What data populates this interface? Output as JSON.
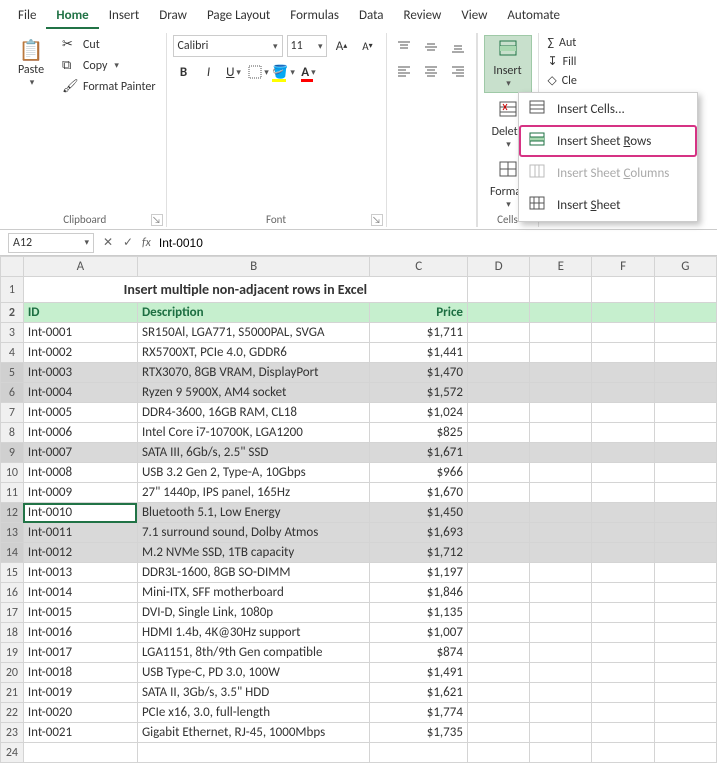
{
  "menu": {
    "items": [
      "File",
      "Home",
      "Insert",
      "Draw",
      "Page Layout",
      "Formulas",
      "Data",
      "Review",
      "View",
      "Automate"
    ],
    "active": "Home"
  },
  "ribbon": {
    "paste": "Paste",
    "cut": "Cut",
    "copy": "Copy",
    "fmtpainter": "Format Painter",
    "clipboard_label": "Clipboard",
    "font_name": "Calibri",
    "font_size": "11",
    "bold": "B",
    "italic": "I",
    "underline": "U",
    "fontA_large": "A",
    "fontA_small": "A",
    "font_label": "Font",
    "insert": "Insert",
    "delete": "Delete",
    "format": "Format",
    "cells_label": "Cells",
    "autosum": "Aut",
    "fill": "Fill",
    "clear": "Cle"
  },
  "dropdown": {
    "insert_cells": "Insert Cells...",
    "insert_rows_pre": "Insert Sheet ",
    "insert_rows_u": "R",
    "insert_rows_post": "ows",
    "insert_cols_pre": "Insert Sheet ",
    "insert_cols_u": "C",
    "insert_cols_post": "olumns",
    "insert_sheet_pre": "Insert ",
    "insert_sheet_u": "S",
    "insert_sheet_post": "heet"
  },
  "namebox": "A12",
  "formula": "Int-0010",
  "cols": [
    "A",
    "B",
    "C",
    "D",
    "E",
    "F",
    "G"
  ],
  "title": "Insert multiple non-adjacent rows in Excel",
  "headers": {
    "id": "ID",
    "desc": "Description",
    "price": "Price"
  },
  "rows": [
    {
      "n": 3,
      "id": "Int-0001",
      "d": "SR150Al, LGA771, S5000PAL, SVGA",
      "p": "$1,711"
    },
    {
      "n": 4,
      "id": "Int-0002",
      "d": "RX5700XT, PCIe 4.0, GDDR6",
      "p": "$1,441"
    },
    {
      "n": 5,
      "id": "Int-0003",
      "d": "RTX3070, 8GB VRAM, DisplayPort",
      "p": "$1,470",
      "sel": true
    },
    {
      "n": 6,
      "id": "Int-0004",
      "d": "Ryzen 9 5900X, AM4 socket",
      "p": "$1,572",
      "sel": true
    },
    {
      "n": 7,
      "id": "Int-0005",
      "d": "DDR4-3600, 16GB RAM, CL18",
      "p": "$1,024"
    },
    {
      "n": 8,
      "id": "Int-0006",
      "d": "Intel Core i7-10700K, LGA1200",
      "p": "$825"
    },
    {
      "n": 9,
      "id": "Int-0007",
      "d": "SATA III, 6Gb/s, 2.5\" SSD",
      "p": "$1,671",
      "sel": true
    },
    {
      "n": 10,
      "id": "Int-0008",
      "d": "USB 3.2 Gen 2, Type-A, 10Gbps",
      "p": "$966"
    },
    {
      "n": 11,
      "id": "Int-0009",
      "d": "27\" 1440p, IPS panel, 165Hz",
      "p": "$1,670"
    },
    {
      "n": 12,
      "id": "Int-0010",
      "d": "Bluetooth 5.1, Low Energy",
      "p": "$1,450",
      "sel": true,
      "active": true
    },
    {
      "n": 13,
      "id": "Int-0011",
      "d": "7.1 surround sound, Dolby Atmos",
      "p": "$1,693",
      "sel": true
    },
    {
      "n": 14,
      "id": "Int-0012",
      "d": "M.2 NVMe SSD, 1TB capacity",
      "p": "$1,712",
      "sel": true
    },
    {
      "n": 15,
      "id": "Int-0013",
      "d": "DDR3L-1600, 8GB SO-DIMM",
      "p": "$1,197"
    },
    {
      "n": 16,
      "id": "Int-0014",
      "d": "Mini-ITX, SFF motherboard",
      "p": "$1,846"
    },
    {
      "n": 17,
      "id": "Int-0015",
      "d": "DVI-D, Single Link, 1080p",
      "p": "$1,135"
    },
    {
      "n": 18,
      "id": "Int-0016",
      "d": "HDMI 1.4b, 4K@30Hz support",
      "p": "$1,007"
    },
    {
      "n": 19,
      "id": "Int-0017",
      "d": "LGA1151, 8th/9th Gen compatible",
      "p": "$874"
    },
    {
      "n": 20,
      "id": "Int-0018",
      "d": "USB Type-C, PD 3.0, 100W",
      "p": "$1,491"
    },
    {
      "n": 21,
      "id": "Int-0019",
      "d": "SATA II, 3Gb/s, 3.5\" HDD",
      "p": "$1,621"
    },
    {
      "n": 22,
      "id": "Int-0020",
      "d": "PCIe x16, 3.0, full-length",
      "p": "$1,774"
    },
    {
      "n": 23,
      "id": "Int-0021",
      "d": "Gigabit Ethernet, RJ-45, 1000Mbps",
      "p": "$1,735"
    },
    {
      "n": 24,
      "id": "",
      "d": "",
      "p": ""
    }
  ]
}
